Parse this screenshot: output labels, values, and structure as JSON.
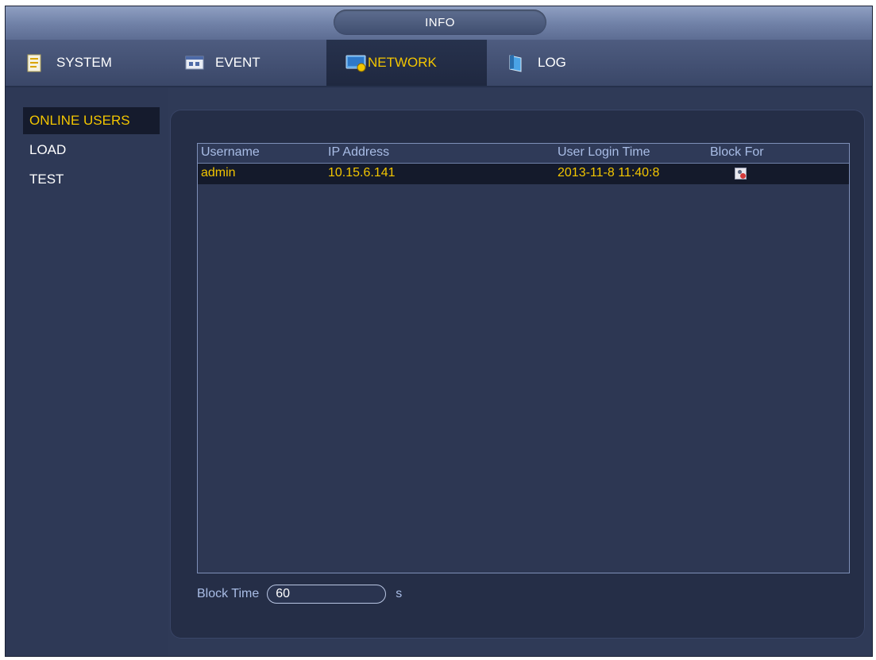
{
  "window": {
    "title": "INFO"
  },
  "tabs": [
    {
      "label": "SYSTEM",
      "icon": "system-icon",
      "active": false
    },
    {
      "label": "EVENT",
      "icon": "event-icon",
      "active": false
    },
    {
      "label": "NETWORK",
      "icon": "network-icon",
      "active": true
    },
    {
      "label": "LOG",
      "icon": "log-icon",
      "active": false
    }
  ],
  "sidebar": {
    "items": [
      {
        "label": "ONLINE USERS",
        "active": true
      },
      {
        "label": "LOAD",
        "active": false
      },
      {
        "label": "TEST",
        "active": false
      }
    ]
  },
  "table": {
    "columns": [
      "Username",
      "IP Address",
      "User Login Time",
      "Block For"
    ],
    "rows": [
      {
        "username": "admin",
        "ip": "10.15.6.141",
        "login_time": "2013-11-8 11:40:8",
        "block_icon": "block-user-icon"
      }
    ]
  },
  "block_time": {
    "label": "Block Time",
    "value": "60",
    "unit": "s"
  },
  "colors": {
    "accent": "#f2c500",
    "header_text": "#a9bde6",
    "background": "#2f3a57"
  }
}
